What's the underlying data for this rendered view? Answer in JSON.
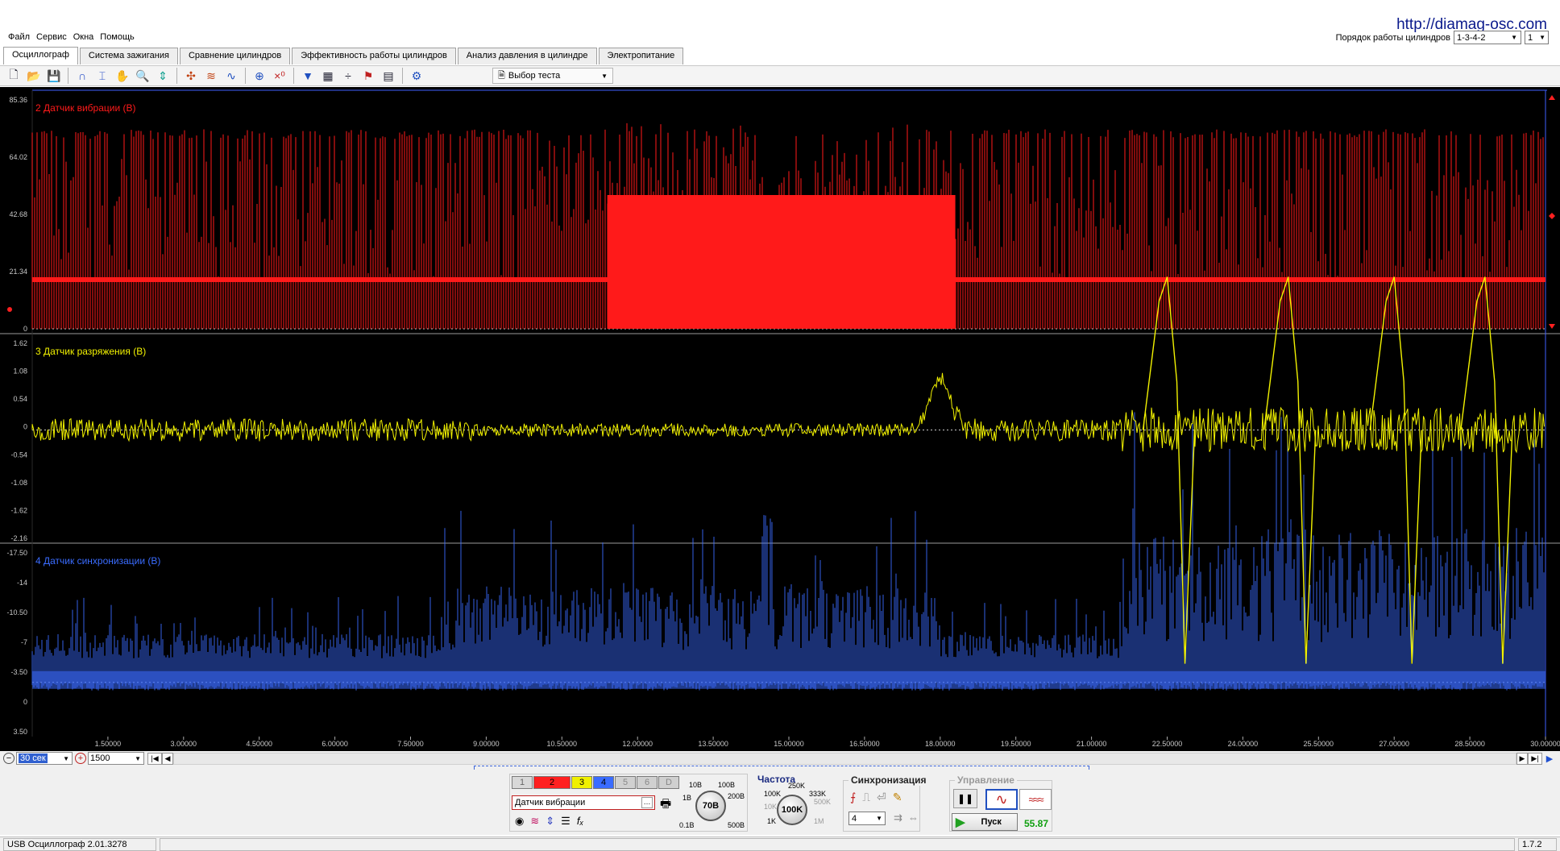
{
  "site_url": "http://diamag-osc.com",
  "menu": [
    "Файл",
    "Сервис",
    "Окна",
    "Помощь"
  ],
  "firing_order": {
    "label": "Порядок работы цилиндров",
    "value": "1-3-4-2",
    "second_value": "1"
  },
  "tabs": [
    "Осциллограф",
    "Система зажигания",
    "Сравнение цилиндров",
    "Эффективность работы цилиндров",
    "Анализ давления в цилиндре",
    "Электропитание"
  ],
  "active_tab": 0,
  "toolbar": {
    "test_select": "Выбор теста"
  },
  "channels": [
    {
      "title": "2 Датчик вибрации (В)",
      "color": "#ff1a1a",
      "ticks": [
        "85.36",
        "64.02",
        "42.68",
        "21.34",
        "0"
      ]
    },
    {
      "title": "3 Датчик разряжения (В)",
      "color": "#f2f200",
      "ticks": [
        "1.62",
        "1.08",
        "0.54",
        "0",
        "-0.54",
        "-1.08",
        "-1.62",
        "-2.16"
      ]
    },
    {
      "title": "4 Датчик синхронизации (В)",
      "color": "#3a6cff",
      "ticks": [
        "-17.50",
        "-14",
        "-10.50",
        "-7",
        "-3.50",
        "0",
        "3.50"
      ]
    }
  ],
  "x_ticks": [
    "1.50000",
    "3.00000",
    "4.50000",
    "6.00000",
    "7.50000",
    "9.00000",
    "10.50000",
    "12.00000",
    "13.50000",
    "15.00000",
    "16.50000",
    "18.00000",
    "19.50000",
    "21.00000",
    "22.50000",
    "24.00000",
    "25.50000",
    "27.00000",
    "28.50000",
    "30.00000"
  ],
  "timebar": {
    "time_value": "30 сек",
    "points_value": "1500"
  },
  "channel_buttons": [
    "1",
    "2",
    "3",
    "4",
    "5",
    "6",
    "D"
  ],
  "channel_button_colors": [
    "#d8d8d8",
    "#ff2020",
    "#f0f000",
    "#3a6cff",
    "#d0d0d0",
    "#d0d0d0",
    "#d0d0d0"
  ],
  "sensor_field": "Датчик вибрации",
  "amplitude_knob": {
    "value": "70В",
    "labels": [
      "10В",
      "100В",
      "1В",
      "200В",
      "0.1В",
      "500В"
    ]
  },
  "frequency": {
    "title": "Частота",
    "value": "100K",
    "labels": [
      "250K",
      "100K",
      "333K",
      "500K",
      "10K",
      "1K",
      "1M"
    ]
  },
  "sync": {
    "title": "Синхронизация",
    "channel": "4"
  },
  "control": {
    "title": "Управление",
    "start_label": "Пуск",
    "fps": "55.87"
  },
  "status": {
    "app": "USB Осциллограф  2.01.3278",
    "version": "1.7.2"
  }
}
